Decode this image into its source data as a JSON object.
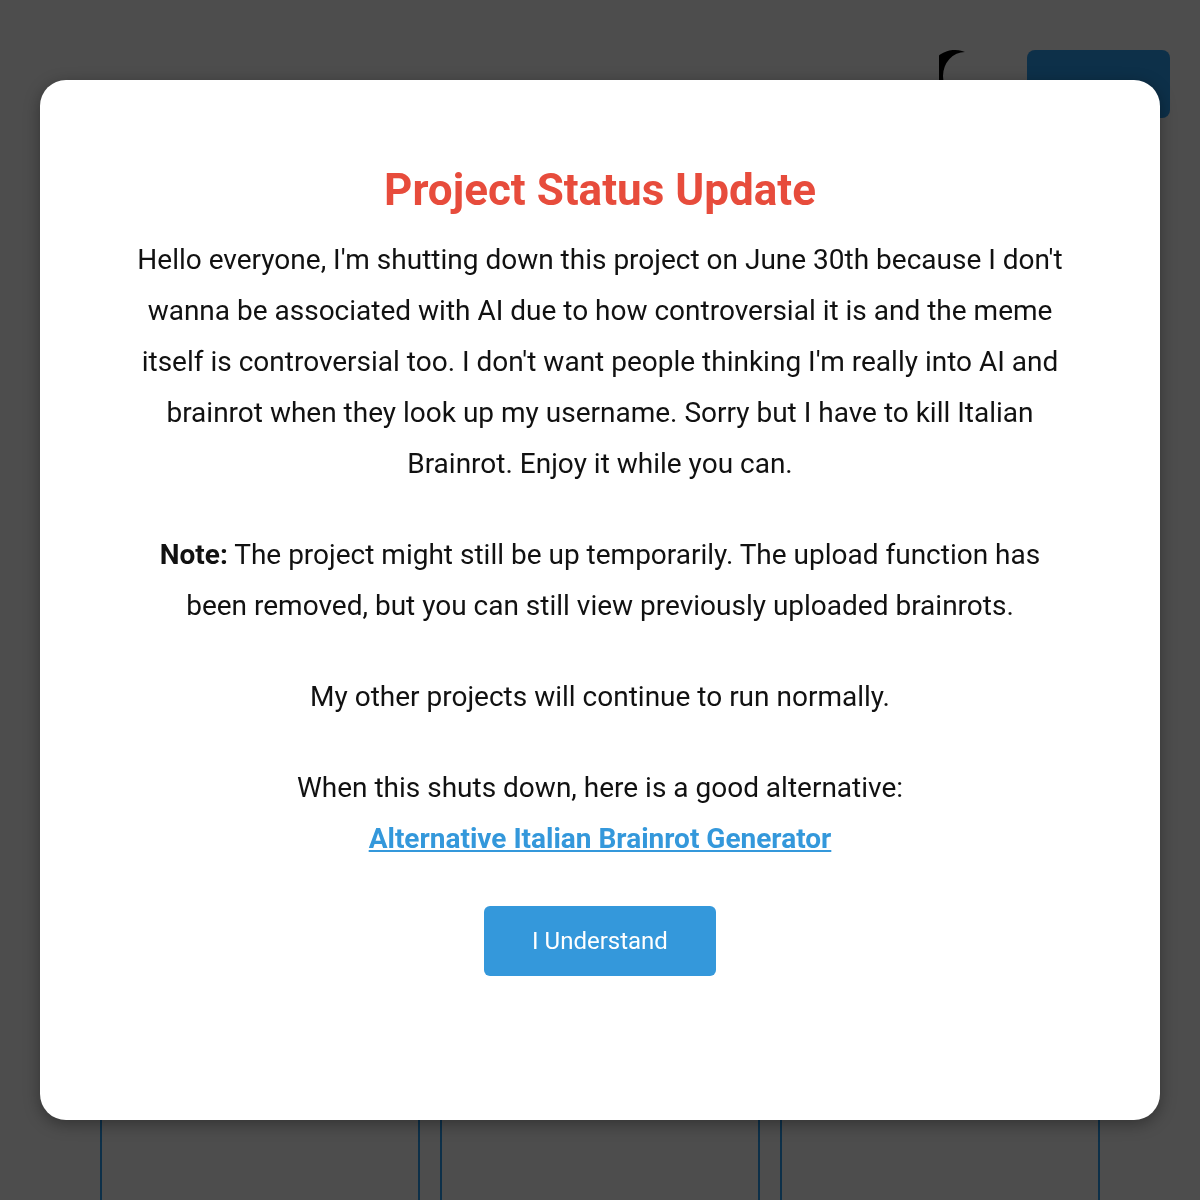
{
  "background": {
    "header": {
      "theme_toggle": {
        "kind": "moon"
      },
      "menu_button": {
        "kind": "button"
      }
    },
    "cards": [
      {
        "kind": "card"
      },
      {
        "kind": "card"
      },
      {
        "kind": "card"
      }
    ]
  },
  "modal": {
    "title": "Project Status Update",
    "paragraphs": [
      {
        "kind": "text",
        "text": "Hello everyone, I'm shutting down this project on June 30th because I don't wanna be associated with AI due to how controversial it is and the meme itself is controversial too. I don't want people thinking I'm really into AI and brainrot when they look up my username. Sorry but I have to kill Italian Brainrot. Enjoy it while you can."
      },
      {
        "kind": "text",
        "text": "**Note:** The project might still be up temporarily. The upload function has been removed, but you can still view previously uploaded brainrots."
      },
      {
        "kind": "text",
        "text": "My other projects will continue to run normally."
      },
      {
        "kind": "link",
        "text": "When this shuts down, here is a good alternative:",
        "link": "Alternative Italian Brainrot Generator"
      }
    ],
    "button": "I Understand"
  }
}
